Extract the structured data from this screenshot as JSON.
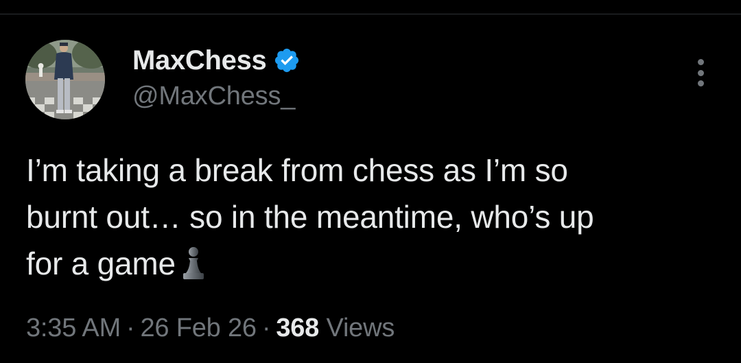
{
  "author": {
    "display_name": "MaxChess",
    "handle": "@MaxChess_",
    "verified": true,
    "verified_color": "#1d9bf0",
    "avatar_icon": "person-on-chessboard-photo"
  },
  "tweet": {
    "lines": [
      "I’m taking a break from chess as I’m so",
      "burnt out… so in the meantime, who’s up",
      "for a game"
    ],
    "emoji": "chess-pawn-icon"
  },
  "meta": {
    "time": "3:35 AM",
    "separator": "·",
    "date": "26 Feb 26",
    "views_count": "368",
    "views_label": "Views"
  },
  "menu": {
    "icon": "more-vertical-icon"
  },
  "colors": {
    "background": "#000000",
    "text_primary": "#e7e9ea",
    "text_secondary": "#71767b",
    "divider": "#2f3336"
  }
}
